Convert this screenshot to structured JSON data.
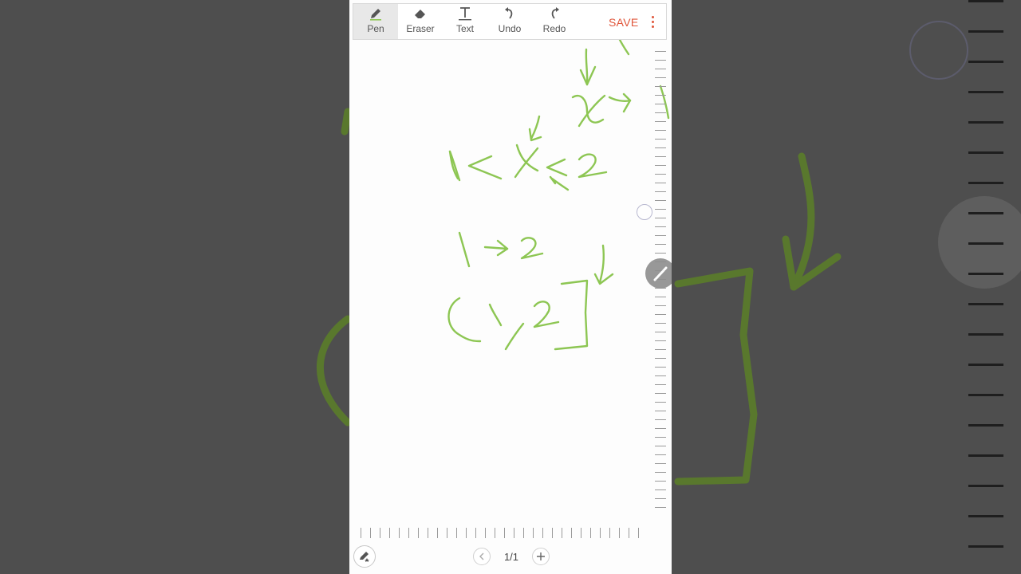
{
  "toolbar": {
    "tools": [
      {
        "label": "Pen",
        "icon": "pen-icon",
        "active": true
      },
      {
        "label": "Eraser",
        "icon": "eraser-icon",
        "active": false
      },
      {
        "label": "Text",
        "icon": "text-icon",
        "active": false
      },
      {
        "label": "Undo",
        "icon": "undo-icon",
        "active": false
      },
      {
        "label": "Redo",
        "icon": "redo-icon",
        "active": false
      }
    ],
    "save_label": "SAVE",
    "more_icon": "more-vertical-icon"
  },
  "pager": {
    "page_indicator": "1/1",
    "prev_icon": "chevron-left-icon",
    "add_icon": "plus-icon"
  },
  "colors": {
    "ink": "#8dc653",
    "accent": "#e0553a",
    "background": "#4e4e4e"
  }
}
